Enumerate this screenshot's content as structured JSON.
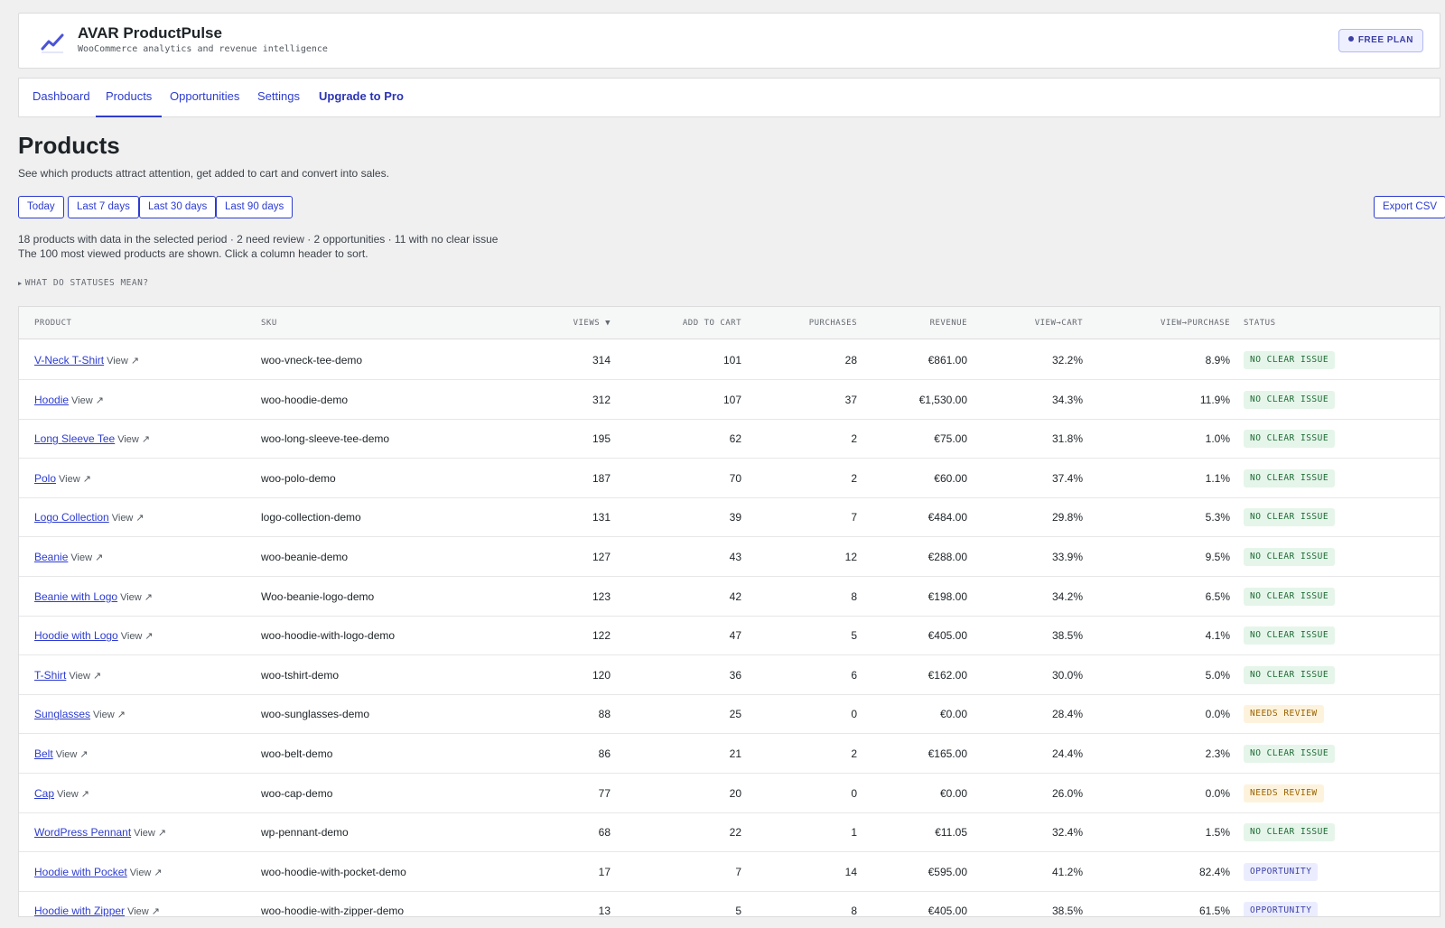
{
  "app": {
    "title": "AVAR ProductPulse",
    "subtitle": "WooCommerce analytics and revenue intelligence",
    "plan_badge": "FREE PLAN",
    "logo_icon": "trend-line-chart-icon",
    "accent": "#2d3ccf"
  },
  "nav": {
    "tabs": [
      {
        "label": "Dashboard",
        "active": false
      },
      {
        "label": "Products",
        "active": true
      },
      {
        "label": "Opportunities",
        "active": false
      },
      {
        "label": "Settings",
        "active": false
      },
      {
        "label": "Upgrade to Pro",
        "active": false
      }
    ]
  },
  "page": {
    "title": "Products",
    "description": "See which products attract attention, get added to cart and convert into sales."
  },
  "filters": {
    "ranges": [
      "Today",
      "Last 7 days",
      "Last 30 days",
      "Last 90 days"
    ],
    "export": "Export CSV"
  },
  "summary": {
    "line1": "18 products with data in the selected period · 2 need review · 2 opportunities · 11 with no clear issue",
    "line2": "The 100 most viewed products are shown. Click a column header to sort."
  },
  "statuses_toggle": "WHAT DO STATUSES MEAN?",
  "table": {
    "headers": {
      "product": "PRODUCT",
      "sku": "SKU",
      "views": "VIEWS ▼",
      "add_to_cart": "ADD TO CART",
      "purchases": "PURCHASES",
      "revenue": "REVENUE",
      "view_cart": "VIEW→CART",
      "view_purchase": "VIEW→PURCHASE",
      "status": "STATUS"
    },
    "view_label": "View ↗",
    "rows": [
      {
        "product": "V-Neck T-Shirt",
        "sku": "woo-vneck-tee-demo",
        "views": "314",
        "cart": "101",
        "purchases": "28",
        "revenue": "€861.00",
        "vc": "32.2%",
        "vp": "8.9%",
        "status": "NO CLEAR ISSUE",
        "kind": "ok"
      },
      {
        "product": "Hoodie",
        "sku": "woo-hoodie-demo",
        "views": "312",
        "cart": "107",
        "purchases": "37",
        "revenue": "€1,530.00",
        "vc": "34.3%",
        "vp": "11.9%",
        "status": "NO CLEAR ISSUE",
        "kind": "ok"
      },
      {
        "product": "Long Sleeve Tee",
        "sku": "woo-long-sleeve-tee-demo",
        "views": "195",
        "cart": "62",
        "purchases": "2",
        "revenue": "€75.00",
        "vc": "31.8%",
        "vp": "1.0%",
        "status": "NO CLEAR ISSUE",
        "kind": "ok"
      },
      {
        "product": "Polo",
        "sku": "woo-polo-demo",
        "views": "187",
        "cart": "70",
        "purchases": "2",
        "revenue": "€60.00",
        "vc": "37.4%",
        "vp": "1.1%",
        "status": "NO CLEAR ISSUE",
        "kind": "ok"
      },
      {
        "product": "Logo Collection",
        "sku": "logo-collection-demo",
        "views": "131",
        "cart": "39",
        "purchases": "7",
        "revenue": "€484.00",
        "vc": "29.8%",
        "vp": "5.3%",
        "status": "NO CLEAR ISSUE",
        "kind": "ok"
      },
      {
        "product": "Beanie",
        "sku": "woo-beanie-demo",
        "views": "127",
        "cart": "43",
        "purchases": "12",
        "revenue": "€288.00",
        "vc": "33.9%",
        "vp": "9.5%",
        "status": "NO CLEAR ISSUE",
        "kind": "ok"
      },
      {
        "product": "Beanie with Logo",
        "sku": "Woo-beanie-logo-demo",
        "views": "123",
        "cart": "42",
        "purchases": "8",
        "revenue": "€198.00",
        "vc": "34.2%",
        "vp": "6.5%",
        "status": "NO CLEAR ISSUE",
        "kind": "ok"
      },
      {
        "product": "Hoodie with Logo",
        "sku": "woo-hoodie-with-logo-demo",
        "views": "122",
        "cart": "47",
        "purchases": "5",
        "revenue": "€405.00",
        "vc": "38.5%",
        "vp": "4.1%",
        "status": "NO CLEAR ISSUE",
        "kind": "ok"
      },
      {
        "product": "T-Shirt",
        "sku": "woo-tshirt-demo",
        "views": "120",
        "cart": "36",
        "purchases": "6",
        "revenue": "€162.00",
        "vc": "30.0%",
        "vp": "5.0%",
        "status": "NO CLEAR ISSUE",
        "kind": "ok"
      },
      {
        "product": "Sunglasses",
        "sku": "woo-sunglasses-demo",
        "views": "88",
        "cart": "25",
        "purchases": "0",
        "revenue": "€0.00",
        "vc": "28.4%",
        "vp": "0.0%",
        "status": "NEEDS REVIEW",
        "kind": "review"
      },
      {
        "product": "Belt",
        "sku": "woo-belt-demo",
        "views": "86",
        "cart": "21",
        "purchases": "2",
        "revenue": "€165.00",
        "vc": "24.4%",
        "vp": "2.3%",
        "status": "NO CLEAR ISSUE",
        "kind": "ok"
      },
      {
        "product": "Cap",
        "sku": "woo-cap-demo",
        "views": "77",
        "cart": "20",
        "purchases": "0",
        "revenue": "€0.00",
        "vc": "26.0%",
        "vp": "0.0%",
        "status": "NEEDS REVIEW",
        "kind": "review"
      },
      {
        "product": "WordPress Pennant",
        "sku": "wp-pennant-demo",
        "views": "68",
        "cart": "22",
        "purchases": "1",
        "revenue": "€11.05",
        "vc": "32.4%",
        "vp": "1.5%",
        "status": "NO CLEAR ISSUE",
        "kind": "ok"
      },
      {
        "product": "Hoodie with Pocket",
        "sku": "woo-hoodie-with-pocket-demo",
        "views": "17",
        "cart": "7",
        "purchases": "14",
        "revenue": "€595.00",
        "vc": "41.2%",
        "vp": "82.4%",
        "status": "OPPORTUNITY",
        "kind": "opp"
      },
      {
        "product": "Hoodie with Zipper",
        "sku": "woo-hoodie-with-zipper-demo",
        "views": "13",
        "cart": "5",
        "purchases": "8",
        "revenue": "€405.00",
        "vc": "38.5%",
        "vp": "61.5%",
        "status": "OPPORTUNITY",
        "kind": "opp"
      }
    ]
  }
}
